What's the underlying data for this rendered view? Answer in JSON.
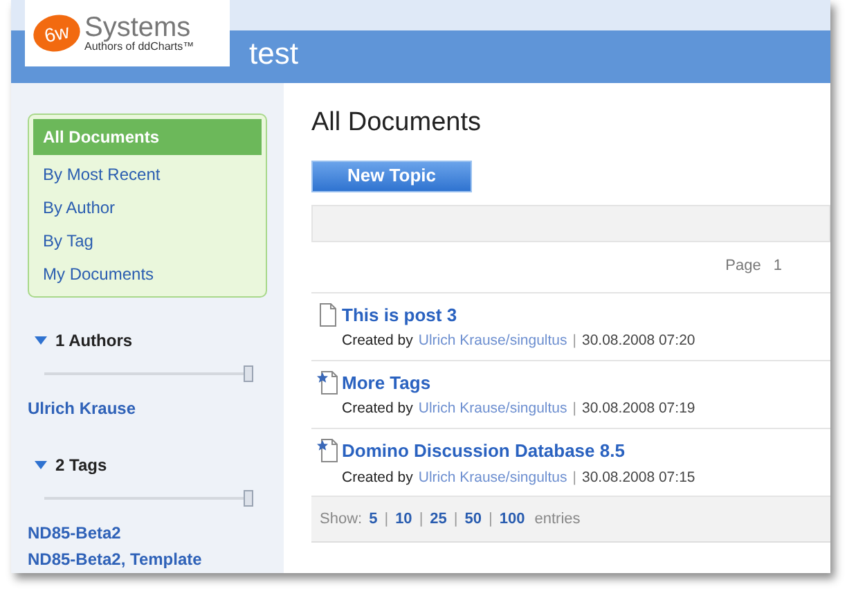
{
  "logo": {
    "mark": "6w",
    "name": "Systems",
    "tagline": "Authors of ddCharts™"
  },
  "header": {
    "title": "test"
  },
  "nav": [
    {
      "label": "All Documents",
      "selected": true
    },
    {
      "label": "By Most Recent",
      "selected": false
    },
    {
      "label": "By Author",
      "selected": false
    },
    {
      "label": "By Tag",
      "selected": false
    },
    {
      "label": "My Documents",
      "selected": false
    }
  ],
  "facets": [
    {
      "title": "1 Authors",
      "expanded": true,
      "level": 1,
      "links": [
        "Ulrich Krause"
      ]
    },
    {
      "title": "2 Tags",
      "expanded": true,
      "level": 1,
      "links": [
        "ND85-Beta2",
        "ND85-Beta2, Template"
      ]
    }
  ],
  "main": {
    "title": "All Documents",
    "new_button": "New Topic",
    "page_label": "Page",
    "page_number": "1"
  },
  "documents": [
    {
      "kind": "document",
      "title": "This is post 3",
      "created_by": "Created by",
      "author": "Ulrich Krause/singultus",
      "separator": "|",
      "date": "30.08.2008 07:20"
    },
    {
      "kind": "starred",
      "title": "More Tags",
      "created_by": "Created by",
      "author": "Ulrich Krause/singultus",
      "separator": "|",
      "date": "30.08.2008 07:19"
    },
    {
      "kind": "starred",
      "title": "Domino Discussion Database 8.5",
      "created_by": "Created by",
      "author": "Ulrich Krause/singultus",
      "separator": "|",
      "date": "30.08.2008 07:15"
    }
  ],
  "footer": {
    "show_label": "Show:",
    "options": [
      "5",
      "10",
      "25",
      "50",
      "100"
    ],
    "separator": "|",
    "entries_label": "entries"
  }
}
